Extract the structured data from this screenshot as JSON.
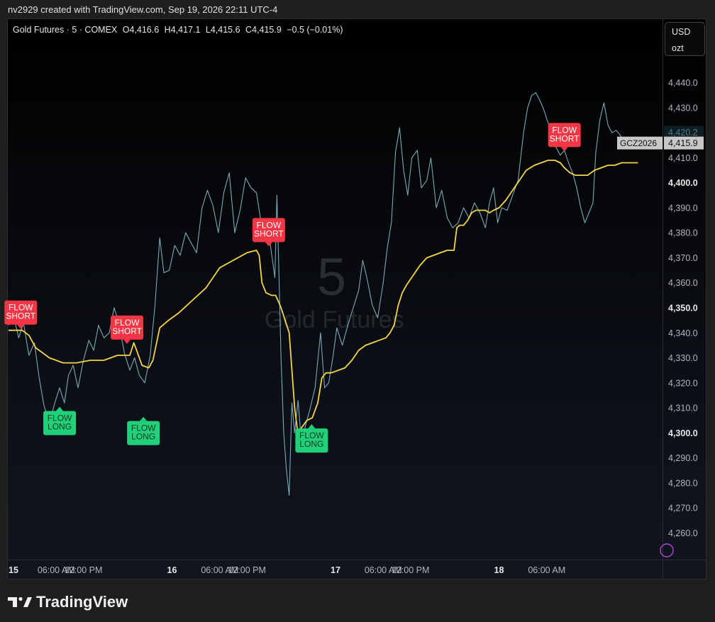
{
  "header": {
    "credit": "nv2929 created with TradingView.com, Sep 19, 2026 22:11 UTC-4"
  },
  "legend": {
    "symbol": "Gold Futures · 5 · COMEX",
    "open": "O4,416.6",
    "high": "H4,417.1",
    "low": "L4,415.6",
    "close": "C4,415.9",
    "change": "−0.5 (−0.01%)"
  },
  "units": {
    "currency": "USD",
    "unit": "ozt"
  },
  "watermark": {
    "interval": "5",
    "name": "Gold Futures"
  },
  "footer": {
    "brand": "TradingView",
    "logo_icon": "tradingview-logo-icon"
  },
  "colors": {
    "price": "#7fb3bf",
    "ma": "#f5d547",
    "short": "#f23645",
    "long": "#22d07a",
    "axis_text": "#b2b5be"
  },
  "chart_data": {
    "type": "line",
    "ylim": [
      4253,
      4447
    ],
    "yticks": [
      {
        "v": 4440,
        "label": "4,440.0",
        "bold": false
      },
      {
        "v": 4430,
        "label": "4,430.0",
        "bold": false
      },
      {
        "v": 4410,
        "label": "4,410.0",
        "bold": false
      },
      {
        "v": 4400,
        "label": "4,400.0",
        "bold": true
      },
      {
        "v": 4390,
        "label": "4,390.0",
        "bold": false
      },
      {
        "v": 4380,
        "label": "4,380.0",
        "bold": false
      },
      {
        "v": 4370,
        "label": "4,370.0",
        "bold": false
      },
      {
        "v": 4360,
        "label": "4,360.0",
        "bold": false
      },
      {
        "v": 4350,
        "label": "4,350.0",
        "bold": true
      },
      {
        "v": 4340,
        "label": "4,340.0",
        "bold": false
      },
      {
        "v": 4330,
        "label": "4,330.0",
        "bold": false
      },
      {
        "v": 4320,
        "label": "4,320.0",
        "bold": false
      },
      {
        "v": 4310,
        "label": "4,310.0",
        "bold": false
      },
      {
        "v": 4300,
        "label": "4,300.0",
        "bold": true
      },
      {
        "v": 4290,
        "label": "4,290.0",
        "bold": false
      },
      {
        "v": 4280,
        "label": "4,280.0",
        "bold": false
      },
      {
        "v": 4270,
        "label": "4,270.0",
        "bold": false
      },
      {
        "v": 4260,
        "label": "4,260.0",
        "bold": false
      }
    ],
    "price_tags": [
      {
        "v": 4420.2,
        "label": "4,420.2",
        "style": "faint"
      },
      {
        "v": 4415.9,
        "label": "4,415.9",
        "style": "last",
        "symbol": "GCZ2026"
      }
    ],
    "xlim": [
      0,
      960
    ],
    "xticks": [
      {
        "x": 0,
        "label": "15",
        "bold": true
      },
      {
        "x": 70,
        "label": "06:00 AM",
        "bold": false
      },
      {
        "x": 110,
        "label": "12:00 PM",
        "bold": false
      },
      {
        "x": 240,
        "label": "16",
        "bold": true
      },
      {
        "x": 310,
        "label": "06:00 AM",
        "bold": false
      },
      {
        "x": 350,
        "label": "12:00 PM",
        "bold": false
      },
      {
        "x": 480,
        "label": "17",
        "bold": true
      },
      {
        "x": 550,
        "label": "06:00 AM",
        "bold": false
      },
      {
        "x": 590,
        "label": "12:00 PM",
        "bold": false
      },
      {
        "x": 720,
        "label": "18",
        "bold": true
      },
      {
        "x": 790,
        "label": "06:00 AM",
        "bold": false
      }
    ],
    "series": [
      {
        "role": "price",
        "points": [
          [
            0,
            4343
          ],
          [
            8,
            4346
          ],
          [
            15,
            4338
          ],
          [
            22,
            4344
          ],
          [
            30,
            4331
          ],
          [
            38,
            4336
          ],
          [
            45,
            4322
          ],
          [
            52,
            4311
          ],
          [
            60,
            4304
          ],
          [
            68,
            4312
          ],
          [
            75,
            4318
          ],
          [
            82,
            4312
          ],
          [
            88,
            4323
          ],
          [
            95,
            4327
          ],
          [
            102,
            4318
          ],
          [
            110,
            4329
          ],
          [
            118,
            4337
          ],
          [
            125,
            4333
          ],
          [
            132,
            4343
          ],
          [
            140,
            4338
          ],
          [
            148,
            4340
          ],
          [
            155,
            4350
          ],
          [
            162,
            4344
          ],
          [
            170,
            4332
          ],
          [
            178,
            4325
          ],
          [
            185,
            4330
          ],
          [
            192,
            4323
          ],
          [
            200,
            4320
          ],
          [
            208,
            4331
          ],
          [
            215,
            4351
          ],
          [
            222,
            4378
          ],
          [
            228,
            4364
          ],
          [
            236,
            4365
          ],
          [
            244,
            4375
          ],
          [
            252,
            4371
          ],
          [
            260,
            4380
          ],
          [
            268,
            4376
          ],
          [
            276,
            4372
          ],
          [
            284,
            4390
          ],
          [
            292,
            4397
          ],
          [
            300,
            4391
          ],
          [
            308,
            4380
          ],
          [
            316,
            4396
          ],
          [
            324,
            4404
          ],
          [
            332,
            4380
          ],
          [
            340,
            4389
          ],
          [
            348,
            4402
          ],
          [
            356,
            4398
          ],
          [
            364,
            4396
          ],
          [
            372,
            4382
          ],
          [
            380,
            4384
          ],
          [
            386,
            4372
          ],
          [
            391,
            4362
          ],
          [
            394,
            4395
          ],
          [
            397,
            4363
          ],
          [
            400,
            4330
          ],
          [
            404,
            4300
          ],
          [
            408,
            4285
          ],
          [
            412,
            4275
          ],
          [
            416,
            4312
          ],
          [
            420,
            4300
          ],
          [
            425,
            4313
          ],
          [
            430,
            4296
          ],
          [
            436,
            4303
          ],
          [
            442,
            4309
          ],
          [
            450,
            4318
          ],
          [
            458,
            4340
          ],
          [
            464,
            4318
          ],
          [
            470,
            4320
          ],
          [
            476,
            4330
          ],
          [
            482,
            4342
          ],
          [
            490,
            4335
          ],
          [
            498,
            4343
          ],
          [
            506,
            4350
          ],
          [
            514,
            4357
          ],
          [
            520,
            4369
          ],
          [
            526,
            4362
          ],
          [
            534,
            4351
          ],
          [
            542,
            4346
          ],
          [
            550,
            4360
          ],
          [
            556,
            4374
          ],
          [
            562,
            4384
          ],
          [
            568,
            4412
          ],
          [
            574,
            4422
          ],
          [
            580,
            4405
          ],
          [
            586,
            4395
          ],
          [
            592,
            4410
          ],
          [
            600,
            4413
          ],
          [
            606,
            4398
          ],
          [
            614,
            4401
          ],
          [
            620,
            4410
          ],
          [
            628,
            4390
          ],
          [
            636,
            4397
          ],
          [
            644,
            4386
          ],
          [
            652,
            4382
          ],
          [
            660,
            4384
          ],
          [
            668,
            4390
          ],
          [
            676,
            4386
          ],
          [
            684,
            4392
          ],
          [
            692,
            4388
          ],
          [
            700,
            4382
          ],
          [
            706,
            4392
          ],
          [
            712,
            4398
          ],
          [
            718,
            4384
          ],
          [
            724,
            4390
          ],
          [
            732,
            4389
          ],
          [
            740,
            4395
          ],
          [
            748,
            4401
          ],
          [
            756,
            4420
          ],
          [
            762,
            4430
          ],
          [
            768,
            4435
          ],
          [
            774,
            4436
          ],
          [
            780,
            4433
          ],
          [
            786,
            4429
          ],
          [
            792,
            4424
          ],
          [
            798,
            4422
          ],
          [
            804,
            4414
          ],
          [
            810,
            4411
          ],
          [
            816,
            4413
          ],
          [
            822,
            4408
          ],
          [
            828,
            4404
          ],
          [
            834,
            4398
          ],
          [
            840,
            4390
          ],
          [
            846,
            4384
          ],
          [
            852,
            4388
          ],
          [
            858,
            4392
          ],
          [
            862,
            4412
          ],
          [
            868,
            4425
          ],
          [
            874,
            4432
          ],
          [
            880,
            4423
          ],
          [
            886,
            4420
          ],
          [
            892,
            4421
          ],
          [
            898,
            4419
          ],
          [
            904,
            4416
          ]
        ]
      },
      {
        "role": "ma",
        "points": [
          [
            0,
            4341
          ],
          [
            20,
            4341
          ],
          [
            30,
            4339
          ],
          [
            40,
            4334
          ],
          [
            60,
            4330
          ],
          [
            80,
            4328
          ],
          [
            100,
            4328
          ],
          [
            120,
            4329
          ],
          [
            140,
            4329
          ],
          [
            160,
            4331
          ],
          [
            170,
            4331
          ],
          [
            178,
            4331
          ],
          [
            184,
            4336
          ],
          [
            188,
            4333
          ],
          [
            196,
            4327
          ],
          [
            206,
            4326
          ],
          [
            212,
            4329
          ],
          [
            222,
            4342
          ],
          [
            235,
            4345
          ],
          [
            250,
            4348
          ],
          [
            270,
            4353
          ],
          [
            290,
            4358
          ],
          [
            310,
            4366
          ],
          [
            330,
            4369
          ],
          [
            350,
            4372
          ],
          [
            364,
            4373
          ],
          [
            368,
            4371
          ],
          [
            372,
            4360
          ],
          [
            378,
            4356
          ],
          [
            386,
            4355
          ],
          [
            392,
            4355
          ],
          [
            397,
            4352
          ],
          [
            400,
            4350
          ],
          [
            412,
            4340
          ],
          [
            420,
            4310
          ],
          [
            426,
            4297
          ],
          [
            430,
            4302
          ],
          [
            438,
            4305
          ],
          [
            446,
            4306
          ],
          [
            454,
            4312
          ],
          [
            460,
            4322
          ],
          [
            466,
            4324
          ],
          [
            474,
            4324
          ],
          [
            484,
            4325
          ],
          [
            494,
            4326
          ],
          [
            504,
            4329
          ],
          [
            514,
            4333
          ],
          [
            524,
            4335
          ],
          [
            534,
            4336
          ],
          [
            544,
            4337
          ],
          [
            554,
            4338
          ],
          [
            560,
            4340
          ],
          [
            566,
            4343
          ],
          [
            572,
            4351
          ],
          [
            578,
            4356
          ],
          [
            584,
            4359
          ],
          [
            594,
            4363
          ],
          [
            604,
            4367
          ],
          [
            614,
            4370
          ],
          [
            624,
            4371
          ],
          [
            634,
            4372
          ],
          [
            644,
            4373
          ],
          [
            650,
            4373
          ],
          [
            654,
            4373
          ],
          [
            658,
            4382
          ],
          [
            662,
            4383
          ],
          [
            668,
            4383
          ],
          [
            674,
            4385
          ],
          [
            680,
            4388
          ],
          [
            686,
            4389
          ],
          [
            692,
            4389
          ],
          [
            700,
            4389
          ],
          [
            706,
            4388
          ],
          [
            712,
            4389
          ],
          [
            720,
            4390
          ],
          [
            730,
            4393
          ],
          [
            740,
            4397
          ],
          [
            750,
            4401
          ],
          [
            760,
            4405
          ],
          [
            772,
            4407
          ],
          [
            782,
            4408
          ],
          [
            792,
            4409
          ],
          [
            802,
            4409
          ],
          [
            810,
            4408
          ],
          [
            816,
            4406
          ],
          [
            824,
            4404
          ],
          [
            832,
            4403
          ],
          [
            840,
            4403
          ],
          [
            850,
            4403
          ],
          [
            860,
            4405
          ],
          [
            870,
            4406
          ],
          [
            880,
            4407
          ],
          [
            890,
            4407
          ],
          [
            900,
            4408
          ],
          [
            910,
            4408
          ],
          [
            924,
            4408
          ]
        ]
      }
    ],
    "annotations": [
      {
        "type": "short",
        "x": 18,
        "y": 4341,
        "lines": [
          "FLOW",
          "SHORT"
        ]
      },
      {
        "type": "long",
        "x": 75,
        "y": 4311,
        "lines": [
          "FLOW",
          "LONG"
        ]
      },
      {
        "type": "short",
        "x": 174,
        "y": 4335,
        "lines": [
          "FLOW",
          "SHORT"
        ]
      },
      {
        "type": "long",
        "x": 198,
        "y": 4307,
        "lines": [
          "FLOW",
          "LONG"
        ]
      },
      {
        "type": "short",
        "x": 382,
        "y": 4374,
        "lines": [
          "FLOW",
          "SHORT"
        ]
      },
      {
        "type": "long",
        "x": 445,
        "y": 4304,
        "lines": [
          "FLOW",
          "LONG"
        ]
      },
      {
        "type": "short",
        "x": 816,
        "y": 4412,
        "lines": [
          "FLOW",
          "SHORT"
        ]
      }
    ]
  }
}
